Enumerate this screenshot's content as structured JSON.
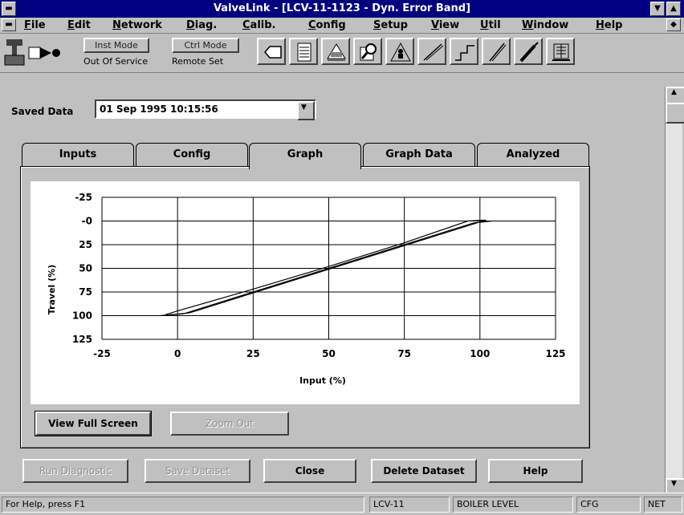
{
  "window": {
    "title": "ValveLink - [LCV-11-1123 - Dyn. Error Band]"
  },
  "menu": {
    "items": [
      "File",
      "Edit",
      "Network",
      "Diag.",
      "Calib.",
      "Config",
      "Setup",
      "View",
      "Util",
      "Window",
      "Help"
    ]
  },
  "toolbar": {
    "inst_mode_label": "Inst Mode",
    "ctrl_mode_label": "Ctrl Mode",
    "inst_mode_status": "Out Of Service",
    "ctrl_mode_status": "Remote Set"
  },
  "saved_data": {
    "label": "Saved Data",
    "value": "01 Sep 1995 10:15:56"
  },
  "tabs": [
    "Inputs",
    "Config",
    "Graph",
    "Graph Data",
    "Analyzed"
  ],
  "active_tab": "Graph",
  "graph_buttons": {
    "full_screen": "View Full Screen",
    "zoom_out": "Zoom Out"
  },
  "bottom_buttons": {
    "run_diag": "Run Diagnostic",
    "save_dataset": "Save Dataset",
    "close": "Close",
    "delete_dataset": "Delete Dataset",
    "help": "Help"
  },
  "status": {
    "help_text": "For Help, press F1",
    "tag": "LCV-11",
    "description": "BOILER LEVEL",
    "mode": "CFG",
    "net": "NET"
  },
  "chart_data": {
    "type": "line",
    "xlabel": "Input (%)",
    "ylabel": "Travel (%)",
    "xlim": [
      -25,
      125
    ],
    "ylim": [
      -25,
      125
    ],
    "y_inverted": true,
    "x_ticks": [
      "-25",
      "0",
      "25",
      "50",
      "75",
      "100",
      "125"
    ],
    "y_ticks": [
      "-25",
      "-0",
      "25",
      "50",
      "75",
      "100",
      "125"
    ],
    "grid": true,
    "series": [
      {
        "x": [
          -6,
          2,
          25,
          50,
          75,
          98,
          104
        ],
        "y": [
          100,
          98,
          75,
          50,
          25,
          2,
          0
        ]
      },
      {
        "x": [
          -4,
          0,
          25,
          50,
          75,
          96,
          102
        ],
        "y": [
          99,
          95,
          72,
          48,
          23,
          0,
          -1
        ]
      },
      {
        "x": [
          -5,
          4,
          27,
          52,
          77,
          100,
          103
        ],
        "y": [
          100,
          97,
          74,
          49,
          24,
          1,
          0
        ]
      }
    ]
  }
}
